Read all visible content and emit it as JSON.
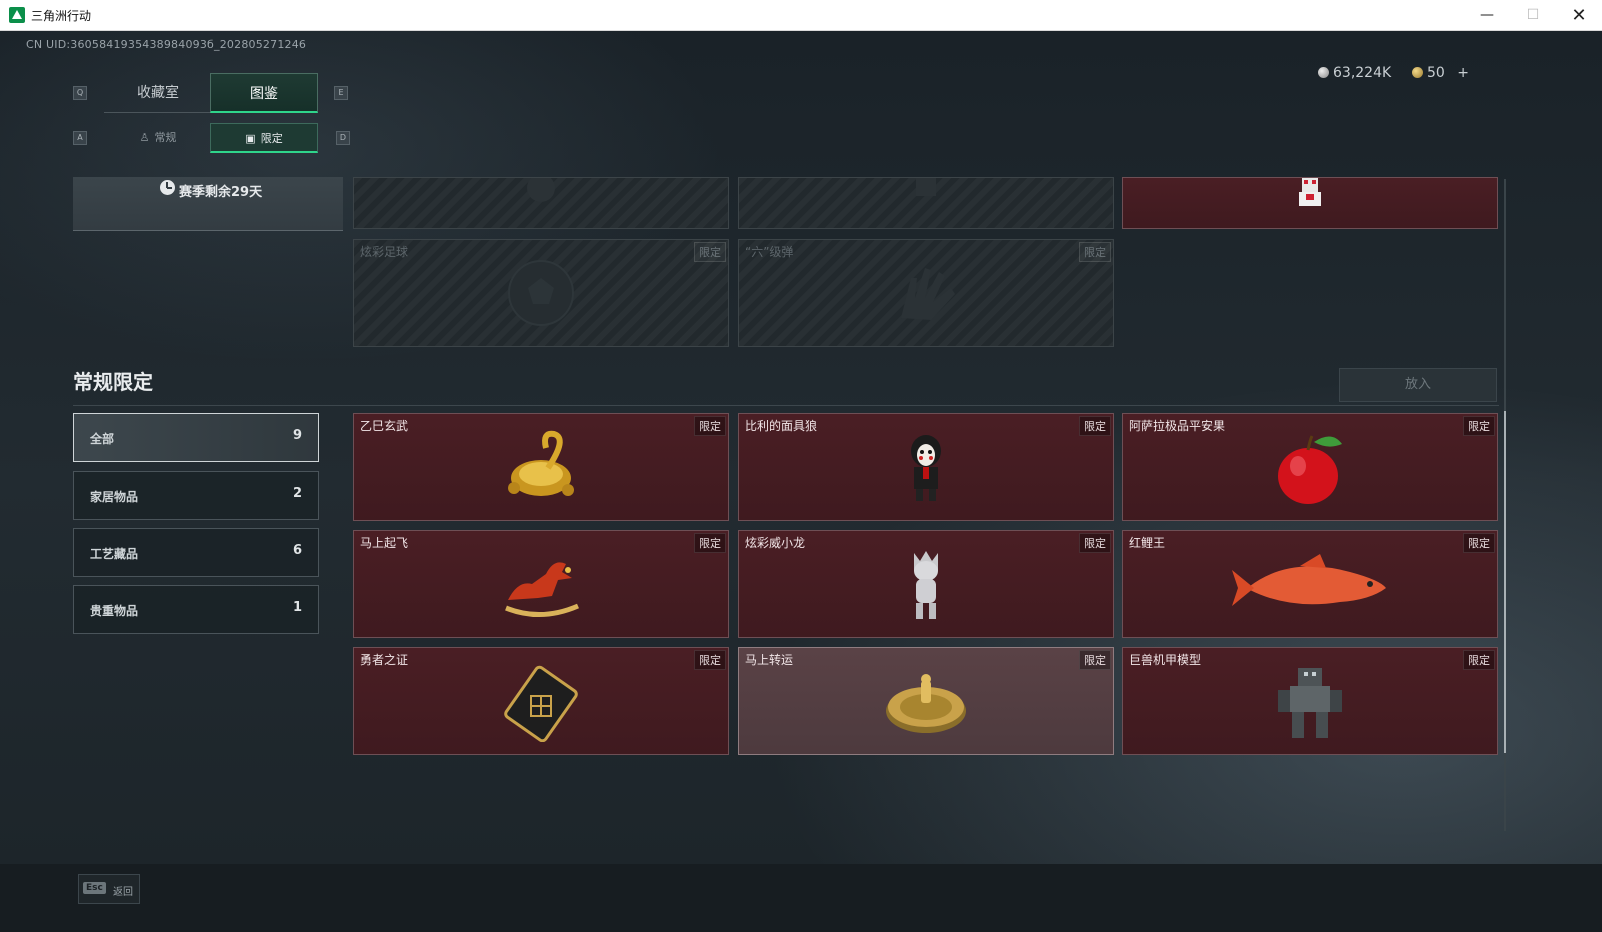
{
  "window": {
    "title": "三角洲行动",
    "minimize": "—",
    "maximize": "☐",
    "close": "✕"
  },
  "uid": "CN UID:3605841935438984093б_202805271246",
  "tabs": {
    "left_key": "Q",
    "right_key": "E",
    "items": [
      {
        "label": "收藏室"
      },
      {
        "label": "图鉴",
        "active": true
      }
    ]
  },
  "subtabs": {
    "left_key": "A",
    "right_key": "D",
    "items": [
      {
        "label": "常规"
      },
      {
        "label": "限定",
        "active": true
      }
    ]
  },
  "currency": {
    "silver": "63,224K",
    "gold": "50",
    "add": "+"
  },
  "season": {
    "text": "赛季剩余29天"
  },
  "top_cards": [
    {
      "name": "",
      "badge": "",
      "state": "locked"
    },
    {
      "name": "",
      "badge": "",
      "state": "locked"
    },
    {
      "name": "",
      "badge": "",
      "state": "owned"
    },
    {
      "name": "炫彩足球",
      "badge": "限定",
      "state": "locked"
    },
    {
      "name": "“六”级弹",
      "badge": "限定",
      "state": "locked"
    }
  ],
  "section": {
    "title": "常规限定",
    "put_button": "放入"
  },
  "filters": [
    {
      "label": "全部",
      "count": "9",
      "active": true
    },
    {
      "label": "家居物品",
      "count": "2"
    },
    {
      "label": "工艺藏品",
      "count": "6"
    },
    {
      "label": "贵重物品",
      "count": "1"
    }
  ],
  "items": [
    {
      "name": "乙巳玄武",
      "badge": "限定",
      "icon": "golden-turtle-icon"
    },
    {
      "name": "比利的面具狼",
      "badge": "限定",
      "icon": "puppet-doll-icon"
    },
    {
      "name": "阿萨拉极品平安果",
      "badge": "限定",
      "icon": "apple-icon"
    },
    {
      "name": "马上起飞",
      "badge": "限定",
      "icon": "horse-figure-icon"
    },
    {
      "name": "炫彩威小龙",
      "badge": "限定",
      "icon": "dragon-figure-icon"
    },
    {
      "name": "红鲤王",
      "badge": "限定",
      "icon": "carp-fish-icon"
    },
    {
      "name": "勇者之证",
      "badge": "限定",
      "icon": "badge-card-icon"
    },
    {
      "name": "马上转运",
      "badge": "限定",
      "icon": "golden-dial-icon"
    },
    {
      "name": "巨兽机甲模型",
      "badge": "限定",
      "icon": "mech-model-icon"
    }
  ],
  "footer": {
    "esc_key": "Esc",
    "back_label": "返回"
  }
}
